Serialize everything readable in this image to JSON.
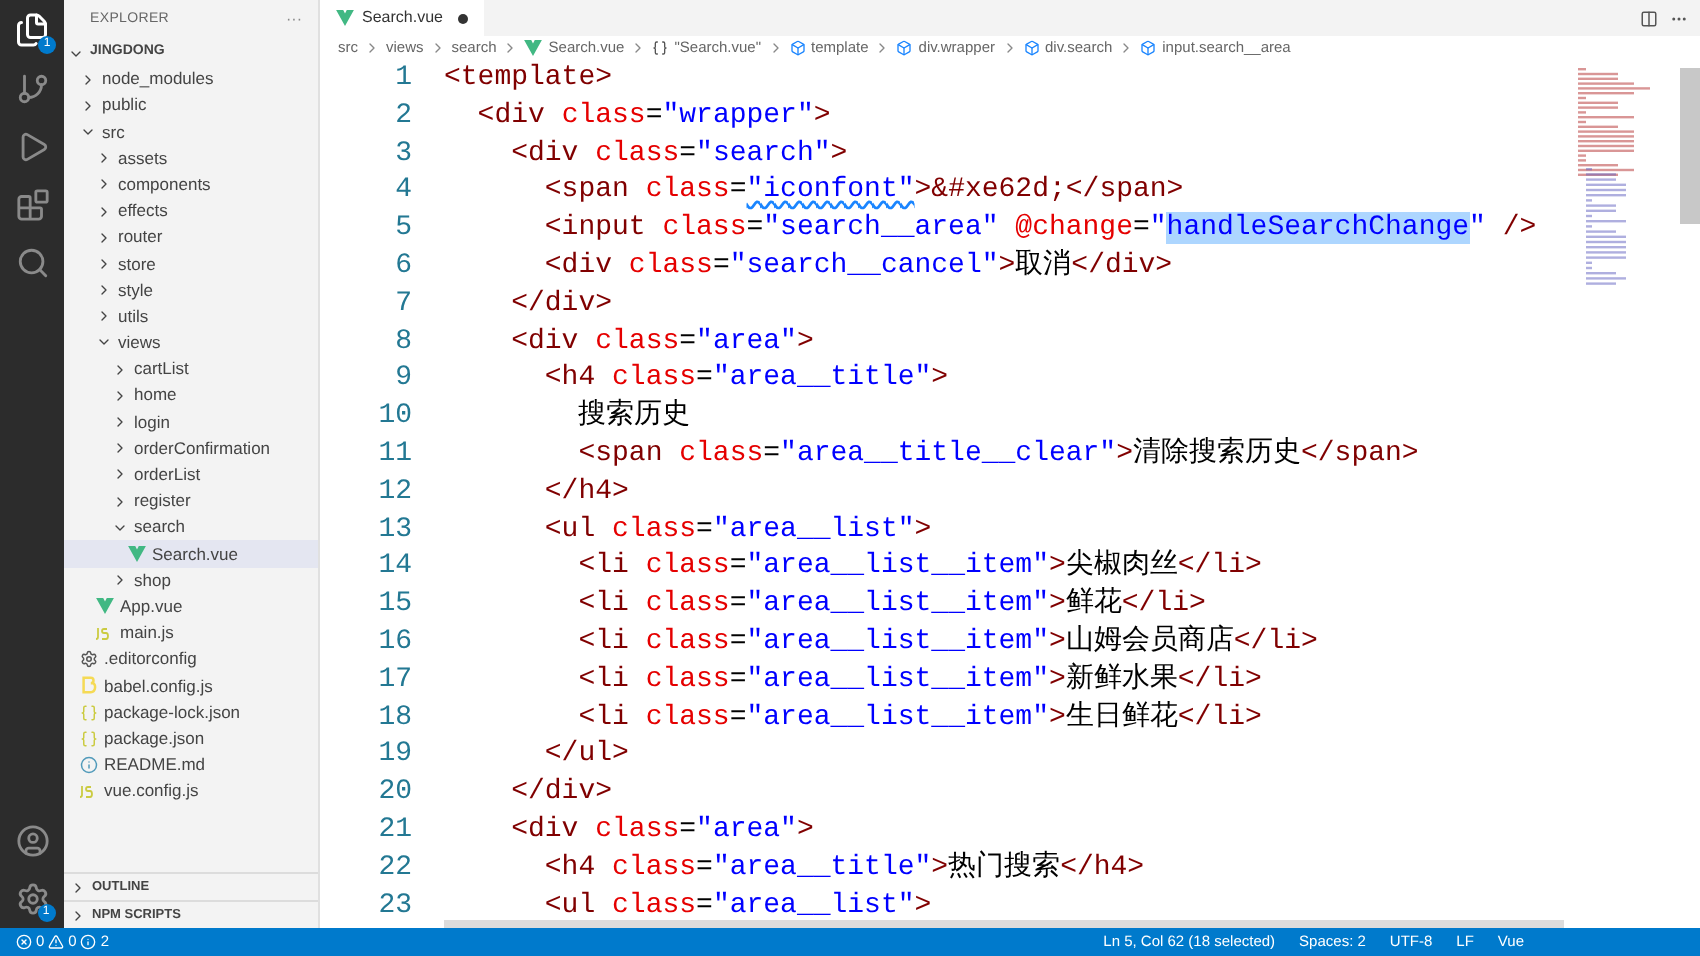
{
  "activity_bar": {
    "explorer_badge": "1",
    "settings_badge": "1"
  },
  "sidebar": {
    "title": "EXPLORER",
    "more": "···",
    "root": {
      "name": "JINGDONG",
      "expanded": true,
      "children": [
        {
          "name": "node_modules",
          "kind": "folder",
          "expanded": false,
          "selected": false
        },
        {
          "name": "public",
          "kind": "folder",
          "expanded": false,
          "selected": false
        },
        {
          "name": "src",
          "kind": "folder",
          "expanded": true,
          "selected": false,
          "children": [
            {
              "name": "assets",
              "kind": "folder",
              "expanded": false,
              "selected": false
            },
            {
              "name": "components",
              "kind": "folder",
              "expanded": false,
              "selected": false
            },
            {
              "name": "effects",
              "kind": "folder",
              "expanded": false,
              "selected": false
            },
            {
              "name": "router",
              "kind": "folder",
              "expanded": false,
              "selected": false
            },
            {
              "name": "store",
              "kind": "folder",
              "expanded": false,
              "selected": false
            },
            {
              "name": "style",
              "kind": "folder",
              "expanded": false,
              "selected": false
            },
            {
              "name": "utils",
              "kind": "folder",
              "expanded": false,
              "selected": false
            },
            {
              "name": "views",
              "kind": "folder",
              "expanded": true,
              "selected": false,
              "children": [
                {
                  "name": "cartList",
                  "kind": "folder",
                  "expanded": false,
                  "selected": false
                },
                {
                  "name": "home",
                  "kind": "folder",
                  "expanded": false,
                  "selected": false
                },
                {
                  "name": "login",
                  "kind": "folder",
                  "expanded": false,
                  "selected": false
                },
                {
                  "name": "orderConfirmation",
                  "kind": "folder",
                  "expanded": false,
                  "selected": false
                },
                {
                  "name": "orderList",
                  "kind": "folder",
                  "expanded": false,
                  "selected": false
                },
                {
                  "name": "register",
                  "kind": "folder",
                  "expanded": false,
                  "selected": false
                },
                {
                  "name": "search",
                  "kind": "folder",
                  "expanded": true,
                  "selected": false,
                  "children": [
                    {
                      "name": "Search.vue",
                      "kind": "vue",
                      "selected": true
                    }
                  ]
                },
                {
                  "name": "shop",
                  "kind": "folder",
                  "expanded": false,
                  "selected": false
                }
              ]
            },
            {
              "name": "App.vue",
              "kind": "vue",
              "selected": false
            },
            {
              "name": "main.js",
              "kind": "js",
              "selected": false
            }
          ]
        },
        {
          "name": ".editorconfig",
          "kind": "config",
          "selected": false
        },
        {
          "name": "babel.config.js",
          "kind": "babel",
          "selected": false
        },
        {
          "name": "package-lock.json",
          "kind": "json",
          "selected": false
        },
        {
          "name": "package.json",
          "kind": "json",
          "selected": false
        },
        {
          "name": "README.md",
          "kind": "info",
          "selected": false
        },
        {
          "name": "vue.config.js",
          "kind": "js",
          "selected": false
        }
      ]
    },
    "panels": [
      {
        "label": "OUTLINE",
        "expanded": false
      },
      {
        "label": "NPM SCRIPTS",
        "expanded": false
      }
    ]
  },
  "tab": {
    "label": "Search.vue",
    "modified": true
  },
  "breadcrumbs": [
    {
      "label": "src",
      "kind": "text"
    },
    {
      "label": "views",
      "kind": "text"
    },
    {
      "label": "search",
      "kind": "text"
    },
    {
      "label": "Search.vue",
      "kind": "vue"
    },
    {
      "label": "\"Search.vue\"",
      "kind": "braces"
    },
    {
      "label": "template",
      "kind": "element"
    },
    {
      "label": "div.wrapper",
      "kind": "element"
    },
    {
      "label": "div.search",
      "kind": "element"
    },
    {
      "label": "input.search__area",
      "kind": "element"
    }
  ],
  "code": [
    {
      "number": "1",
      "tokens": [
        {
          "kind": "tag",
          "text": "<template>"
        }
      ]
    },
    {
      "number": "2",
      "tokens": [
        {
          "kind": "tag",
          "text": "  <div "
        },
        {
          "kind": "attr",
          "text": "class"
        },
        {
          "kind": "text",
          "text": "="
        },
        {
          "kind": "value",
          "text": "\"wrapper\""
        },
        {
          "kind": "tag",
          "text": ">"
        }
      ]
    },
    {
      "number": "3",
      "tokens": [
        {
          "kind": "tag",
          "text": "    <div "
        },
        {
          "kind": "attr",
          "text": "class"
        },
        {
          "kind": "text",
          "text": "="
        },
        {
          "kind": "value",
          "text": "\"search\""
        },
        {
          "kind": "tag",
          "text": ">"
        }
      ]
    },
    {
      "number": "4",
      "tokens": [
        {
          "kind": "tag",
          "text": "      <span "
        },
        {
          "kind": "attr",
          "text": "class"
        },
        {
          "kind": "text",
          "text": "="
        },
        {
          "kind": "spelling",
          "text": "\"iconfont\""
        },
        {
          "kind": "tag",
          "text": ">"
        },
        {
          "kind": "entity",
          "text": "&#xe62d;"
        },
        {
          "kind": "tag",
          "text": "</span>"
        }
      ]
    },
    {
      "number": "5",
      "tokens": [
        {
          "kind": "tag",
          "text": "      <input "
        },
        {
          "kind": "attr",
          "text": "class"
        },
        {
          "kind": "text",
          "text": "="
        },
        {
          "kind": "value",
          "text": "\"search__area\" "
        },
        {
          "kind": "attr",
          "text": "@change"
        },
        {
          "kind": "text",
          "text": "="
        },
        {
          "kind": "value",
          "text": "\""
        },
        {
          "kind": "selection",
          "text": "handleSearchChange"
        },
        {
          "kind": "value",
          "text": "\""
        },
        {
          "kind": "tag",
          "text": " />"
        }
      ]
    },
    {
      "number": "6",
      "tokens": [
        {
          "kind": "tag",
          "text": "      <div "
        },
        {
          "kind": "attr",
          "text": "class"
        },
        {
          "kind": "text",
          "text": "="
        },
        {
          "kind": "value",
          "text": "\"search__cancel\""
        },
        {
          "kind": "tag",
          "text": ">"
        },
        {
          "kind": "text",
          "text": "取消"
        },
        {
          "kind": "tag",
          "text": "</div>"
        }
      ]
    },
    {
      "number": "7",
      "tokens": [
        {
          "kind": "tag",
          "text": "    </div>"
        }
      ]
    },
    {
      "number": "8",
      "tokens": [
        {
          "kind": "tag",
          "text": "    <div "
        },
        {
          "kind": "attr",
          "text": "class"
        },
        {
          "kind": "text",
          "text": "="
        },
        {
          "kind": "value",
          "text": "\"area\""
        },
        {
          "kind": "tag",
          "text": ">"
        }
      ]
    },
    {
      "number": "9",
      "tokens": [
        {
          "kind": "tag",
          "text": "      <h4 "
        },
        {
          "kind": "attr",
          "text": "class"
        },
        {
          "kind": "text",
          "text": "="
        },
        {
          "kind": "value",
          "text": "\"area__title\""
        },
        {
          "kind": "tag",
          "text": ">"
        }
      ]
    },
    {
      "number": "10",
      "tokens": [
        {
          "kind": "text",
          "text": "        搜索历史"
        }
      ]
    },
    {
      "number": "11",
      "tokens": [
        {
          "kind": "tag",
          "text": "        <span "
        },
        {
          "kind": "attr",
          "text": "class"
        },
        {
          "kind": "text",
          "text": "="
        },
        {
          "kind": "value",
          "text": "\"area__title__clear\""
        },
        {
          "kind": "tag",
          "text": ">"
        },
        {
          "kind": "text",
          "text": "清除搜索历史"
        },
        {
          "kind": "tag",
          "text": "</span>"
        }
      ]
    },
    {
      "number": "12",
      "tokens": [
        {
          "kind": "tag",
          "text": "      </h4>"
        }
      ]
    },
    {
      "number": "13",
      "tokens": [
        {
          "kind": "tag",
          "text": "      <ul "
        },
        {
          "kind": "attr",
          "text": "class"
        },
        {
          "kind": "text",
          "text": "="
        },
        {
          "kind": "value",
          "text": "\"area__list\""
        },
        {
          "kind": "tag",
          "text": ">"
        }
      ]
    },
    {
      "number": "14",
      "tokens": [
        {
          "kind": "tag",
          "text": "        <li "
        },
        {
          "kind": "attr",
          "text": "class"
        },
        {
          "kind": "text",
          "text": "="
        },
        {
          "kind": "value",
          "text": "\"area__list__item\""
        },
        {
          "kind": "tag",
          "text": ">"
        },
        {
          "kind": "text",
          "text": "尖椒肉丝"
        },
        {
          "kind": "tag",
          "text": "</li>"
        }
      ]
    },
    {
      "number": "15",
      "tokens": [
        {
          "kind": "tag",
          "text": "        <li "
        },
        {
          "kind": "attr",
          "text": "class"
        },
        {
          "kind": "text",
          "text": "="
        },
        {
          "kind": "value",
          "text": "\"area__list__item\""
        },
        {
          "kind": "tag",
          "text": ">"
        },
        {
          "kind": "text",
          "text": "鲜花"
        },
        {
          "kind": "tag",
          "text": "</li>"
        }
      ]
    },
    {
      "number": "16",
      "tokens": [
        {
          "kind": "tag",
          "text": "        <li "
        },
        {
          "kind": "attr",
          "text": "class"
        },
        {
          "kind": "text",
          "text": "="
        },
        {
          "kind": "value",
          "text": "\"area__list__item\""
        },
        {
          "kind": "tag",
          "text": ">"
        },
        {
          "kind": "text",
          "text": "山姆会员商店"
        },
        {
          "kind": "tag",
          "text": "</li>"
        }
      ]
    },
    {
      "number": "17",
      "tokens": [
        {
          "kind": "tag",
          "text": "        <li "
        },
        {
          "kind": "attr",
          "text": "class"
        },
        {
          "kind": "text",
          "text": "="
        },
        {
          "kind": "value",
          "text": "\"area__list__item\""
        },
        {
          "kind": "tag",
          "text": ">"
        },
        {
          "kind": "text",
          "text": "新鲜水果"
        },
        {
          "kind": "tag",
          "text": "</li>"
        }
      ]
    },
    {
      "number": "18",
      "tokens": [
        {
          "kind": "tag",
          "text": "        <li "
        },
        {
          "kind": "attr",
          "text": "class"
        },
        {
          "kind": "text",
          "text": "="
        },
        {
          "kind": "value",
          "text": "\"area__list__item\""
        },
        {
          "kind": "tag",
          "text": ">"
        },
        {
          "kind": "text",
          "text": "生日鲜花"
        },
        {
          "kind": "tag",
          "text": "</li>"
        }
      ]
    },
    {
      "number": "19",
      "tokens": [
        {
          "kind": "tag",
          "text": "      </ul>"
        }
      ]
    },
    {
      "number": "20",
      "tokens": [
        {
          "kind": "tag",
          "text": "    </div>"
        }
      ]
    },
    {
      "number": "21",
      "tokens": [
        {
          "kind": "tag",
          "text": "    <div "
        },
        {
          "kind": "attr",
          "text": "class"
        },
        {
          "kind": "text",
          "text": "="
        },
        {
          "kind": "value",
          "text": "\"area\""
        },
        {
          "kind": "tag",
          "text": ">"
        }
      ]
    },
    {
      "number": "22",
      "tokens": [
        {
          "kind": "tag",
          "text": "      <h4 "
        },
        {
          "kind": "attr",
          "text": "class"
        },
        {
          "kind": "text",
          "text": "="
        },
        {
          "kind": "value",
          "text": "\"area__title\""
        },
        {
          "kind": "tag",
          "text": ">"
        },
        {
          "kind": "text",
          "text": "热门搜索"
        },
        {
          "kind": "tag",
          "text": "</h4>"
        }
      ]
    },
    {
      "number": "23",
      "tokens": [
        {
          "kind": "tag",
          "text": "      <ul "
        },
        {
          "kind": "attr",
          "text": "class"
        },
        {
          "kind": "text",
          "text": "="
        },
        {
          "kind": "value",
          "text": "\"area__list\""
        },
        {
          "kind": "tag",
          "text": ">"
        }
      ]
    }
  ],
  "status_bar": {
    "errors": "0",
    "warnings": "0",
    "infos": "2",
    "items": [
      "Ln 5, Col 62 (18 selected)",
      "Spaces: 2",
      "UTF-8",
      "LF",
      "Vue"
    ]
  }
}
